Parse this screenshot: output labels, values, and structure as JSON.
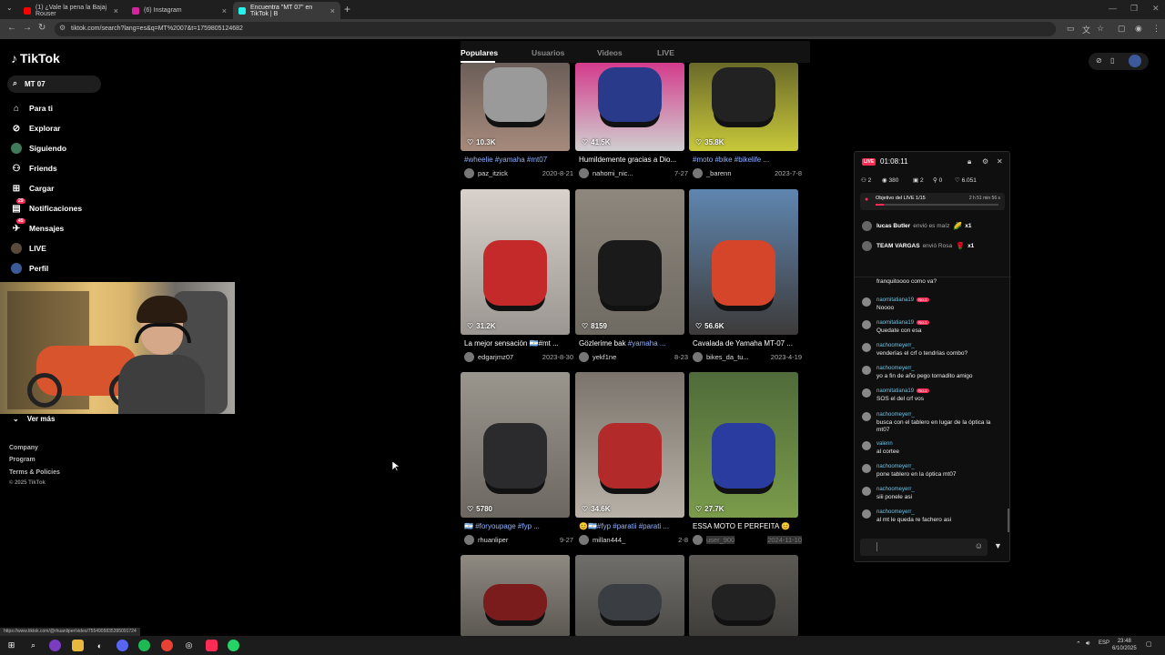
{
  "browser": {
    "tabs": [
      {
        "title": "(1) ¿Vale la pena la Bajaj Rouser",
        "color": "#ff0000"
      },
      {
        "title": "(6) Instagram",
        "color": "#d6249f"
      },
      {
        "title": "Encuentra \"MT 07\" en TikTok | B",
        "color": "#25f4ee"
      }
    ],
    "url": "tiktok.com/search?lang=es&q=MT%2007&t=1759805124682"
  },
  "sidebar": {
    "logo": "TikTok",
    "search_value": "MT 07",
    "items": [
      {
        "label": "Para ti",
        "icon": "home-icon"
      },
      {
        "label": "Explorar",
        "icon": "compass-icon"
      },
      {
        "label": "Siguiendo",
        "icon": "following-avatar"
      },
      {
        "label": "Friends",
        "icon": "friends-icon"
      },
      {
        "label": "Cargar",
        "icon": "upload-icon"
      },
      {
        "label": "Notificaciones",
        "icon": "bell-icon",
        "badge": "29"
      },
      {
        "label": "Mensajes",
        "icon": "message-icon",
        "badge": "45"
      },
      {
        "label": "LIVE",
        "icon": "live-icon"
      },
      {
        "label": "Perfil",
        "icon": "profile-avatar"
      }
    ],
    "ver_mas": "Ver más",
    "footer": [
      "Company",
      "Program",
      "Terms & Policies"
    ],
    "copyright": "© 2025 TikTok"
  },
  "search_tabs": [
    "Populares",
    "Usuarios",
    "Videos",
    "LIVE"
  ],
  "videos": [
    {
      "likes": "10.3K",
      "title_tag": "#wheelie #yamaha #mt07",
      "title": "",
      "user": "paz_itzick",
      "date": "2020-8-21",
      "colors": [
        "#6b5e58",
        "#a68a7c"
      ],
      "bike": "#9a9a9a"
    },
    {
      "likes": "41.5K",
      "title": "Humildemente gracias a Dio...",
      "title_tag": "",
      "user": "nahomi_nic...",
      "date": "7-27",
      "colors": [
        "#d43b8c",
        "#cfcfcf"
      ],
      "bike": "#2a3a8a"
    },
    {
      "likes": "35.8K",
      "title_tag": "#moto #bike #bikelife ...",
      "title": "",
      "user": "_barenn",
      "date": "2023-7-8",
      "colors": [
        "#6a6a2a",
        "#c8c83a"
      ],
      "bike": "#222222"
    },
    {
      "likes": "31.2K",
      "title": "La mejor sensación 🇦🇷#mt ...",
      "title_tag": "",
      "user": "edgarjmz07",
      "date": "2023-8-30",
      "colors": [
        "#d9d2cc",
        "#9b9691"
      ],
      "bike": "#c42a2a"
    },
    {
      "likes": "8159",
      "title": "Gözlerime bak ",
      "title_tag": "#yamaha ...",
      "user": "yekf1ne",
      "date": "8-23",
      "colors": [
        "#8d877d",
        "#6f6a62"
      ],
      "bike": "#1a1a1a"
    },
    {
      "likes": "56.6K",
      "title": "Cavalada de Yamaha MT-07 ...",
      "title_tag": "",
      "user": "bikes_da_tu...",
      "date": "2023-4-19",
      "colors": [
        "#5f86b0",
        "#3d3b3a"
      ],
      "bike": "#d4452a"
    },
    {
      "likes": "5780",
      "title": "🇦🇷 ",
      "title_tag": "#foryoupage #fyp ...",
      "user": "rhuanliper",
      "date": "9-27",
      "colors": [
        "#9a968e",
        "#6c6760"
      ],
      "bike": "#2b2b2e"
    },
    {
      "likes": "34.6K",
      "title": "😊🇦🇷",
      "title_tag": "#fyp #paratii #parati ...",
      "user": "millan444_",
      "date": "2-8",
      "colors": [
        "#7a746c",
        "#b7b1a8"
      ],
      "bike": "#b32a2a"
    },
    {
      "likes": "27.7K",
      "title": "ESSA MOTO E PERFEITA 😊",
      "title_tag": "",
      "user": "user_900",
      "date": "2024-11-10",
      "colors": [
        "#4f6b3a",
        "#7a9c4a"
      ],
      "bike": "#2a3ca0"
    },
    {
      "likes": "",
      "title": "",
      "title_tag": "",
      "user": "",
      "date": "",
      "colors": [
        "#8e8a82",
        "#5c5852"
      ],
      "bike": "#7a1c1c"
    },
    {
      "likes": "",
      "title": "",
      "title_tag": "",
      "user": "",
      "date": "",
      "colors": [
        "#6f6e6a",
        "#4c4b48"
      ],
      "bike": "#3a3d42"
    },
    {
      "likes": "",
      "title": "",
      "title_tag": "",
      "user": "",
      "date": "",
      "colors": [
        "#5d5a55",
        "#3f3d3a"
      ],
      "bike": "#222222"
    }
  ],
  "live": {
    "badge": "LIVE",
    "time": "01:08:11",
    "stats": [
      "2",
      "380",
      "2",
      "0",
      "6.051"
    ],
    "goal_label": "Objetivo del LIVE 1/15",
    "goal_time": "2 h 51 min 56 s",
    "goal_progress": 0.07,
    "gifts": [
      {
        "user": "lucas Butler",
        "action": "envió es maíz",
        "count": "x1",
        "icon": "🌽"
      },
      {
        "user": "TEAM VARGAS",
        "action": "envió Rosa",
        "count": "x1",
        "icon": "🌹"
      }
    ],
    "messages": [
      {
        "user": "",
        "level": "",
        "text": "franquitoooo como va?"
      },
      {
        "user": "naomitatiana19",
        "level": "No.1",
        "text": "Noooo"
      },
      {
        "user": "naomitatiana19",
        "level": "No.1",
        "text": "Quedate con esa"
      },
      {
        "user": "nachoomeyerr_",
        "level": "",
        "text": "venderías el crf o tendrías combo?"
      },
      {
        "user": "nachoomeyerr_",
        "level": "",
        "text": "yo a fin de año pego tornadito amigo"
      },
      {
        "user": "naomitatiana19",
        "level": "No.1",
        "text": "SOS el del crf vos"
      },
      {
        "user": "nachoomeyerr_",
        "level": "",
        "text": "busca con el tablero en lugar de la óptica la mt07"
      },
      {
        "user": "valenn",
        "level": "",
        "text": "al cortee"
      },
      {
        "user": "nachoomeyerr_",
        "level": "",
        "text": "pone tablero en la óptica mt07"
      },
      {
        "user": "nachoomeyerr_",
        "level": "",
        "text": "siii ponele asi"
      },
      {
        "user": "nachoomeyerr_",
        "level": "",
        "text": "al mt le queda re fachero asi"
      }
    ]
  },
  "status_link": "https://www.tiktok.com/@rhuanliper/video/7554905835395091724",
  "taskbar": {
    "lang": "ESP",
    "time": "23:48",
    "date": "6/10/2025"
  }
}
